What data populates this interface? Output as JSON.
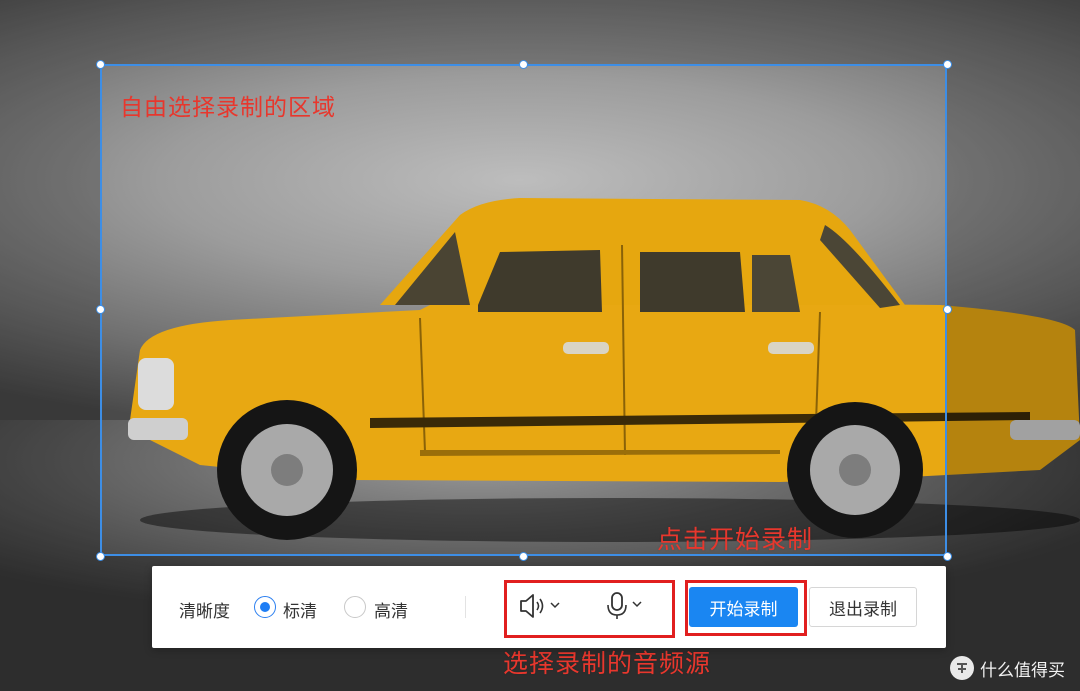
{
  "region": {
    "label": "自由选择录制的区域"
  },
  "annotations": {
    "start_hint": "点击开始录制",
    "audio_hint": "选择录制的音频源"
  },
  "toolbar": {
    "clarity_label": "清晰度",
    "options": [
      {
        "label": "标清",
        "checked": true
      },
      {
        "label": "高清",
        "checked": false
      }
    ],
    "speaker_icon": "speaker-icon",
    "mic_icon": "microphone-icon",
    "start_label": "开始录制",
    "exit_label": "退出录制"
  },
  "watermark": {
    "text": "什么值得买"
  },
  "colors": {
    "accent": "#1a86f2",
    "selection": "#3d8ee6",
    "annotation": "#e8372d"
  }
}
